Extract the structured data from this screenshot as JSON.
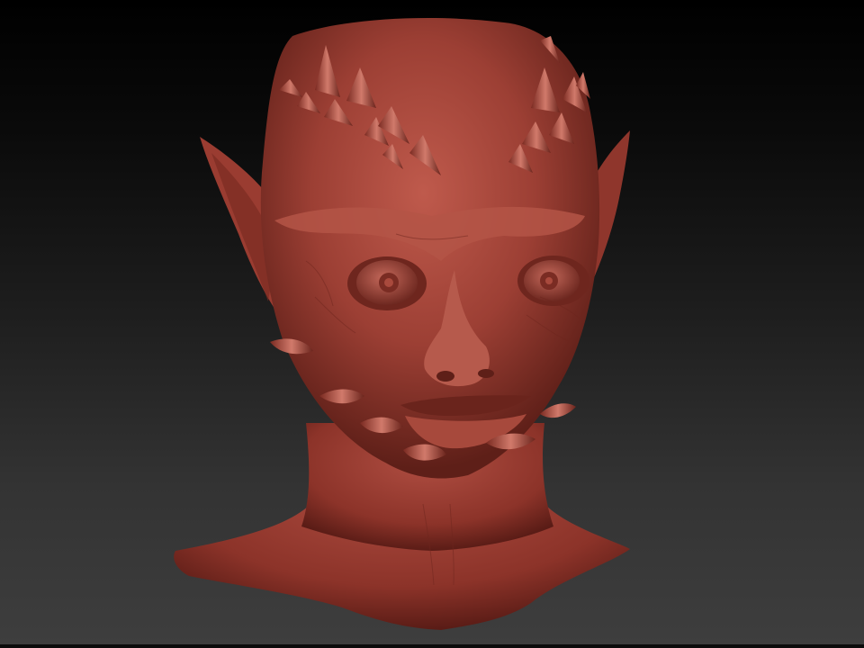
{
  "viewport": {
    "background_top": "#000000",
    "background_bottom": "#3e3e3e"
  },
  "model": {
    "subject": "sculpted-creature-head",
    "material_color": "#a8453a",
    "highlight_color": "#c96a5c",
    "shadow_color": "#5e1f18"
  }
}
